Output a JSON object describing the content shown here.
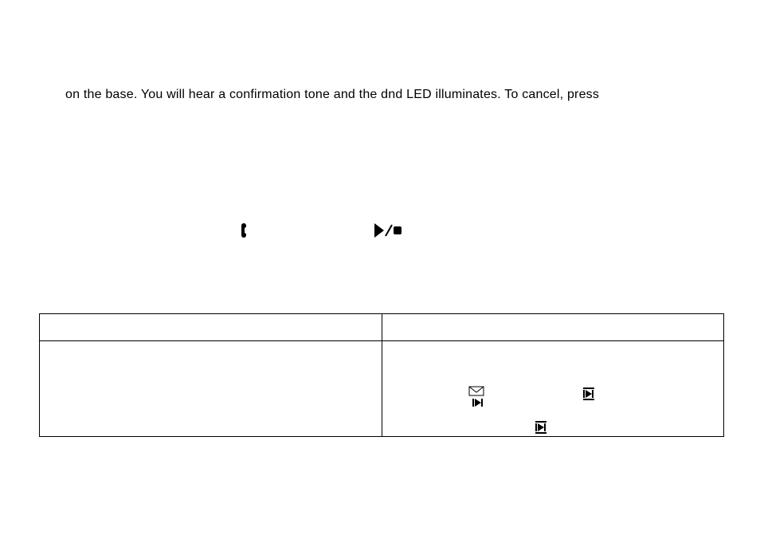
{
  "paragraph": {
    "line1": "on the base. You will hear a confirmation tone and the dnd LED illuminates. To cancel, press"
  },
  "icons": {
    "handset": "handset-icon",
    "playstop": "play-stop-icon",
    "skipA": "mail-skip-icon",
    "skipB": "skip-icon",
    "skipC": "skip-icon"
  },
  "table": {
    "header": {
      "left": "",
      "right": ""
    },
    "body": {
      "left": "",
      "right": ""
    }
  }
}
